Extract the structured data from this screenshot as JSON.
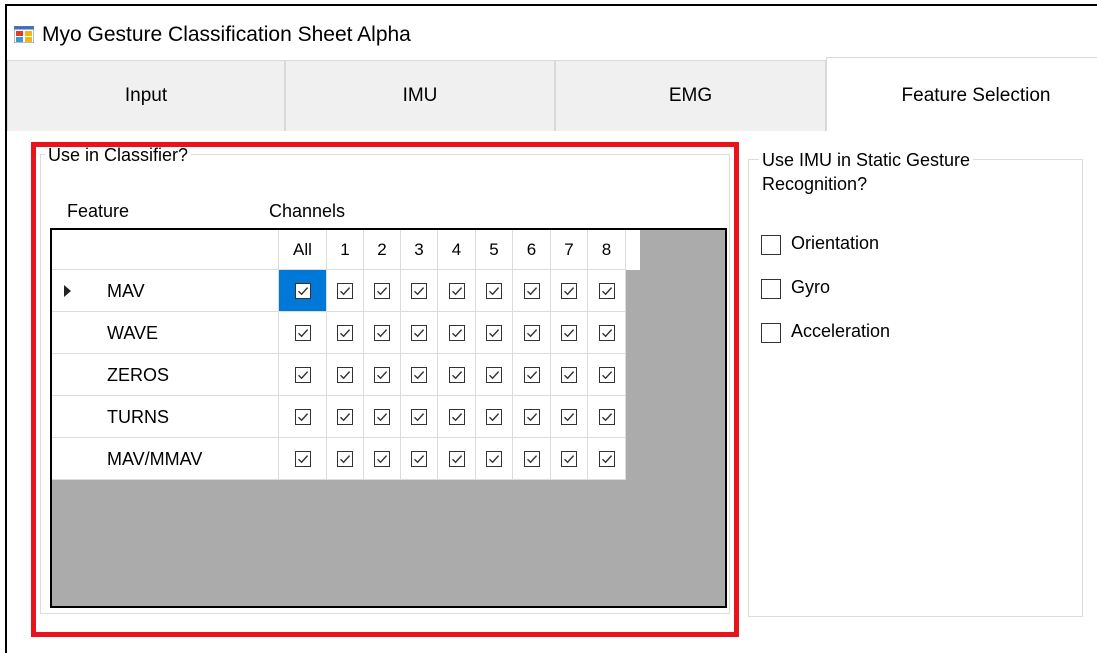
{
  "window": {
    "title": "Myo Gesture Classification Sheet Alpha"
  },
  "tabs": [
    {
      "label": "Input"
    },
    {
      "label": "IMU"
    },
    {
      "label": "EMG"
    },
    {
      "label": "Feature Selection",
      "selected": true
    }
  ],
  "classifier": {
    "group_title": "Use in Classifier?",
    "feature_label": "Feature",
    "channels_label": "Channels",
    "columns": [
      "All",
      "1",
      "2",
      "3",
      "4",
      "5",
      "6",
      "7",
      "8"
    ],
    "rows": [
      {
        "name": "MAV",
        "current": true,
        "checked": [
          true,
          true,
          true,
          true,
          true,
          true,
          true,
          true,
          true
        ]
      },
      {
        "name": "WAVE",
        "checked": [
          true,
          true,
          true,
          true,
          true,
          true,
          true,
          true,
          true
        ]
      },
      {
        "name": "ZEROS",
        "checked": [
          true,
          true,
          true,
          true,
          true,
          true,
          true,
          true,
          true
        ]
      },
      {
        "name": "TURNS",
        "checked": [
          true,
          true,
          true,
          true,
          true,
          true,
          true,
          true,
          true
        ]
      },
      {
        "name": "MAV/MMAV",
        "checked": [
          true,
          true,
          true,
          true,
          true,
          true,
          true,
          true,
          true
        ]
      }
    ]
  },
  "imu": {
    "group_title_line1": "Use IMU in Static Gesture",
    "group_title_line2": "Recognition?",
    "options": [
      {
        "label": "Orientation",
        "checked": false
      },
      {
        "label": "Gyro",
        "checked": false
      },
      {
        "label": "Acceleration",
        "checked": false
      }
    ]
  },
  "colors": {
    "highlight": "#e8141c",
    "selection": "#0078d7",
    "grid_background": "#ababab"
  }
}
